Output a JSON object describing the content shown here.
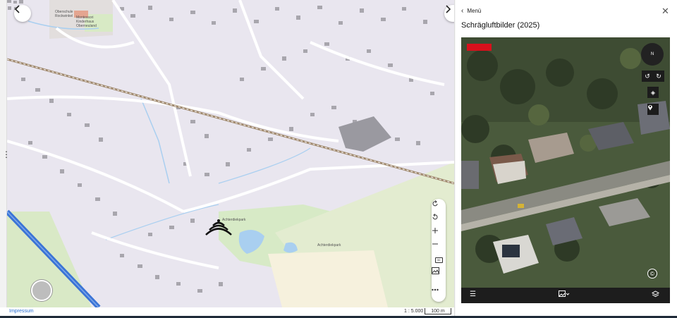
{
  "map": {
    "labels": [
      "Oberschule Rockwinkel",
      "Montessori Kinderhaus Oberneuland",
      "Achterdiekpark",
      "Achterdiekpark"
    ],
    "footer": {
      "impressum": "Impressum",
      "scale_ratio": "1 : 5.000",
      "scale_bar": "100 m"
    },
    "toolbar": [
      "rotate-right-icon",
      "rotate-left-icon",
      "zoom-in-icon",
      "zoom-out-icon",
      "3d-icon",
      "aerial-image-icon",
      "more-icon"
    ],
    "toolbar_3d_label": "3D"
  },
  "panel": {
    "menu_label": "Menü",
    "title": "Schrägluftbilder (2025)",
    "compass_label": "N",
    "copyright_symbol": "©"
  },
  "colors": {
    "map_bg": "#e9e6ef",
    "green": "#d4e8c3",
    "water": "#a9cff0",
    "road": "#ffffff",
    "highway": "#3b74d6",
    "building": "#a8a6ad",
    "rail": "#a0896e",
    "accent_red": "#d8101c"
  }
}
